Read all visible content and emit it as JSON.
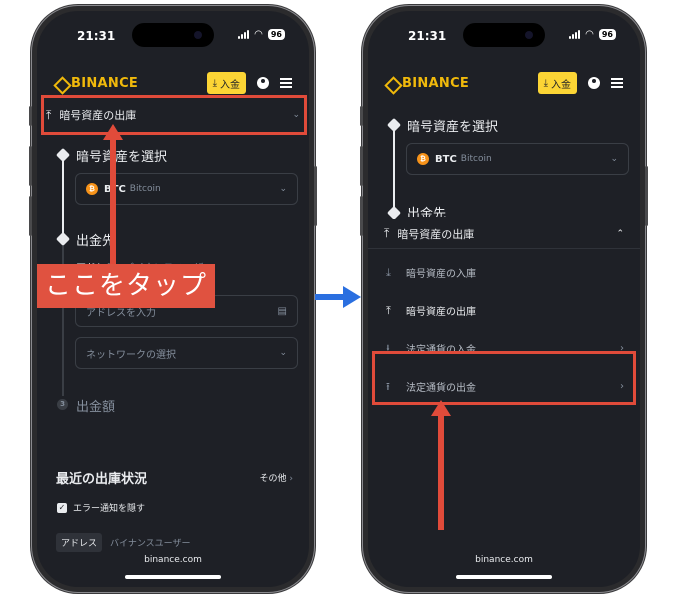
{
  "left_phone": {
    "status": {
      "time": "21:31",
      "battery": "96"
    },
    "nav": {
      "logo": "BINANCE",
      "deposit_label": "入金"
    },
    "dropdown": {
      "label": "暗号資産の出庫"
    },
    "step1": {
      "title": "暗号資産を選択",
      "coin_symbol": "BTC",
      "coin_name": "Bitcoin"
    },
    "step2": {
      "title": "出金先",
      "address_tab": "アドレス",
      "address_tab_alt": "バイナンスユーザー",
      "address_placeholder": "アドレスを入力",
      "network_placeholder": "ネットワークの選択"
    },
    "step3": {
      "title": "出金額"
    },
    "recent": {
      "title": "最近の出庫状況",
      "more": "その他",
      "checkbox_label": "エラー通知を隠す",
      "tab_address": "アドレス",
      "tab_user": "バイナンスユーザー"
    },
    "url": "binance.com",
    "callout": "ここをタップ"
  },
  "right_phone": {
    "status": {
      "time": "21:31",
      "battery": "96"
    },
    "nav": {
      "logo": "BINANCE",
      "deposit_label": "入金"
    },
    "step1": {
      "title": "暗号資産を選択",
      "coin_symbol": "BTC",
      "coin_name": "Bitcoin"
    },
    "step2_partial": "出金先",
    "menu": {
      "header": "暗号資産の出庫",
      "items": [
        {
          "label": "暗号資産の入庫"
        },
        {
          "label": "暗号資産の出庫"
        },
        {
          "label": "法定通貨の入金"
        },
        {
          "label": "法定通貨の出金"
        }
      ]
    },
    "url": "binance.com"
  },
  "colors": {
    "accent": "#f0b90b",
    "highlight": "#e04b3a",
    "arrow_blue": "#2a6fe0",
    "screen_bg": "#1e2026"
  }
}
